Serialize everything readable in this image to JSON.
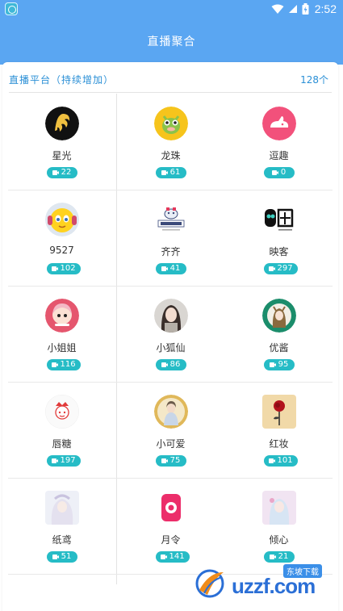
{
  "status_bar": {
    "time": "2:52"
  },
  "header": {
    "title": "直播聚合"
  },
  "section": {
    "title": "直播平台（持续增加）",
    "count": "128个"
  },
  "platforms": [
    {
      "name": "星光",
      "count": "22",
      "icon": "star-light-avatar"
    },
    {
      "name": "龙珠",
      "count": "61",
      "icon": "dragon-ball-avatar"
    },
    {
      "name": "逗趣",
      "count": "0",
      "icon": "rabbit-avatar"
    },
    {
      "name": "9527",
      "count": "102",
      "icon": "emoji-avatar"
    },
    {
      "name": "齐齐",
      "count": "41",
      "icon": "qiqi-avatar"
    },
    {
      "name": "映客",
      "count": "297",
      "icon": "yingke-avatar"
    },
    {
      "name": "小姐姐",
      "count": "116",
      "icon": "girl-avatar"
    },
    {
      "name": "小狐仙",
      "count": "86",
      "icon": "fox-avatar"
    },
    {
      "name": "优酱",
      "count": "95",
      "icon": "youjiang-avatar"
    },
    {
      "name": "唇糖",
      "count": "197",
      "icon": "lips-avatar"
    },
    {
      "name": "小可爱",
      "count": "75",
      "icon": "cute-avatar"
    },
    {
      "name": "红妆",
      "count": "101",
      "icon": "rose-avatar"
    },
    {
      "name": "纸鸢",
      "count": "51",
      "icon": "kite-avatar"
    },
    {
      "name": "月令",
      "count": "141",
      "icon": "yueling-avatar"
    },
    {
      "name": "倾心",
      "count": "21",
      "icon": "qingxin-avatar"
    }
  ],
  "watermark": {
    "text": "uzzf.com",
    "tag": "东坡下载"
  },
  "colors": {
    "header": "#5aa6f2",
    "badge": "#26bcc6",
    "accent_text": "#2a8fd6"
  }
}
